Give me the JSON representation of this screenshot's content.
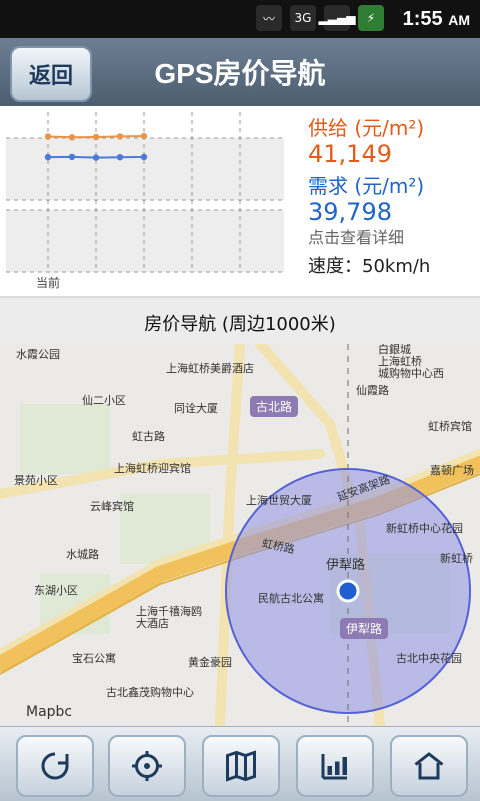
{
  "status_bar": {
    "time": "1:55",
    "ampm": "AM",
    "network": "3G"
  },
  "header": {
    "back_label": "返回",
    "title": "GPS房价导航"
  },
  "chart_panel": {
    "info": {
      "supply_label": "供给 (元/m²)",
      "supply_value": "41,149",
      "demand_label": "需求 (元/m²)",
      "demand_value": "39,798",
      "detail_link": "点击查看详细",
      "speed": "速度：50km/h"
    },
    "xaxis_label": "当前"
  },
  "section": {
    "title": "房价导航 (周边1000米)"
  },
  "map": {
    "pois": [
      {
        "name": "水霞公园"
      },
      {
        "name": "上海虹桥美爵酒店"
      },
      {
        "name": "白銀城\n上海虹桥\n城购物中心西"
      },
      {
        "name": "仙二小区"
      },
      {
        "name": "同诠大厦"
      },
      {
        "name": "古北路"
      },
      {
        "name": "仙霞路"
      },
      {
        "name": "虹桥宾馆"
      },
      {
        "name": "虹古路"
      },
      {
        "name": "上海虹桥迎宾馆"
      },
      {
        "name": "景苑小区"
      },
      {
        "name": "嘉顿广场"
      },
      {
        "name": "云峰宾馆"
      },
      {
        "name": "上海世贸大厦"
      },
      {
        "name": "延安高架路"
      },
      {
        "name": "新虹桥中心花园"
      },
      {
        "name": "水城路"
      },
      {
        "name": "虹桥路"
      },
      {
        "name": "伊犁路"
      },
      {
        "name": "新虹桥"
      },
      {
        "name": "东湖小区"
      },
      {
        "name": "民航古北公寓"
      },
      {
        "name": "上海千禧海鸥大酒店"
      },
      {
        "name": "伊犁路"
      },
      {
        "name": "宝石公寓"
      },
      {
        "name": "黄金豪园"
      },
      {
        "name": "古北中央花园"
      },
      {
        "name": "古北鑫茂购物中心"
      }
    ],
    "logo": "Mapbc"
  },
  "toolbar": {
    "buttons": [
      {
        "icon": "refresh-icon"
      },
      {
        "icon": "locate-icon"
      },
      {
        "icon": "map-icon"
      },
      {
        "icon": "chart-icon"
      },
      {
        "icon": "house-icon"
      }
    ]
  },
  "chart_data": {
    "type": "line",
    "x": [
      1,
      2,
      3,
      4,
      5
    ],
    "series": [
      {
        "values": [
          41149,
          41100,
          41120,
          41160,
          41180
        ],
        "color": "#e8944a"
      },
      {
        "values": [
          39798,
          39810,
          39760,
          39790,
          39800
        ],
        "color": "#4c7bd8"
      }
    ],
    "xlabel": "当前",
    "ylim": [
      37500,
      42500
    ],
    "grid": true
  }
}
